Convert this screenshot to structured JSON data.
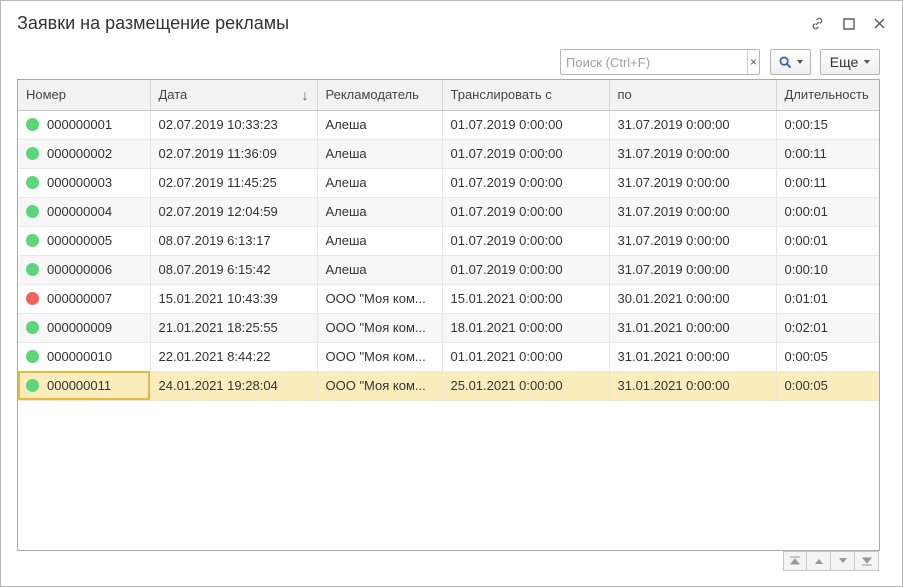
{
  "window": {
    "title": "Заявки на размещение рекламы"
  },
  "colors": {
    "status_ok": "#5cd67a",
    "status_err": "#f0625a",
    "selected_row": "#fbedbb"
  },
  "toolbar": {
    "search_placeholder": "Поиск (Ctrl+F)",
    "search_clear": "×",
    "more_label": "Еще"
  },
  "table": {
    "headers": [
      "Номер",
      "Дата",
      "Рекламодатель",
      "Транслировать с",
      "по",
      "Длительность"
    ],
    "sort_column": "Дата",
    "sort_glyph": "↓",
    "rows": [
      {
        "status": "ok",
        "number": "000000001",
        "date": "02.07.2019 10:33:23",
        "advertiser": "Алеша",
        "from": "01.07.2019 0:00:00",
        "to": "31.07.2019 0:00:00",
        "duration": "0:00:15"
      },
      {
        "status": "ok",
        "number": "000000002",
        "date": "02.07.2019 11:36:09",
        "advertiser": "Алеша",
        "from": "01.07.2019 0:00:00",
        "to": "31.07.2019 0:00:00",
        "duration": "0:00:11"
      },
      {
        "status": "ok",
        "number": "000000003",
        "date": "02.07.2019 11:45:25",
        "advertiser": "Алеша",
        "from": "01.07.2019 0:00:00",
        "to": "31.07.2019 0:00:00",
        "duration": "0:00:11"
      },
      {
        "status": "ok",
        "number": "000000004",
        "date": "02.07.2019 12:04:59",
        "advertiser": "Алеша",
        "from": "01.07.2019 0:00:00",
        "to": "31.07.2019 0:00:00",
        "duration": "0:00:01"
      },
      {
        "status": "ok",
        "number": "000000005",
        "date": "08.07.2019 6:13:17",
        "advertiser": "Алеша",
        "from": "01.07.2019 0:00:00",
        "to": "31.07.2019 0:00:00",
        "duration": "0:00:01"
      },
      {
        "status": "ok",
        "number": "000000006",
        "date": "08.07.2019 6:15:42",
        "advertiser": "Алеша",
        "from": "01.07.2019 0:00:00",
        "to": "31.07.2019 0:00:00",
        "duration": "0:00:10"
      },
      {
        "status": "err",
        "number": "000000007",
        "date": "15.01.2021 10:43:39",
        "advertiser": "ООО \"Моя ком...",
        "from": "15.01.2021 0:00:00",
        "to": "30.01.2021 0:00:00",
        "duration": "0:01:01"
      },
      {
        "status": "ok",
        "number": "000000009",
        "date": "21.01.2021 18:25:55",
        "advertiser": "ООО \"Моя ком...",
        "from": "18.01.2021 0:00:00",
        "to": "31.01.2021 0:00:00",
        "duration": "0:02:01"
      },
      {
        "status": "ok",
        "number": "000000010",
        "date": "22.01.2021 8:44:22",
        "advertiser": "ООО \"Моя ком...",
        "from": "01.01.2021 0:00:00",
        "to": "31.01.2021 0:00:00",
        "duration": "0:00:05"
      },
      {
        "status": "ok",
        "number": "000000011",
        "date": "24.01.2021 19:28:04",
        "advertiser": "ООО \"Моя ком...",
        "from": "25.01.2021 0:00:00",
        "to": "31.01.2021 0:00:00",
        "duration": "0:00:05",
        "selected": true
      }
    ]
  },
  "navigation": {
    "buttons": [
      "first-page-icon",
      "prev-row-icon",
      "next-row-icon",
      "last-page-icon"
    ]
  }
}
